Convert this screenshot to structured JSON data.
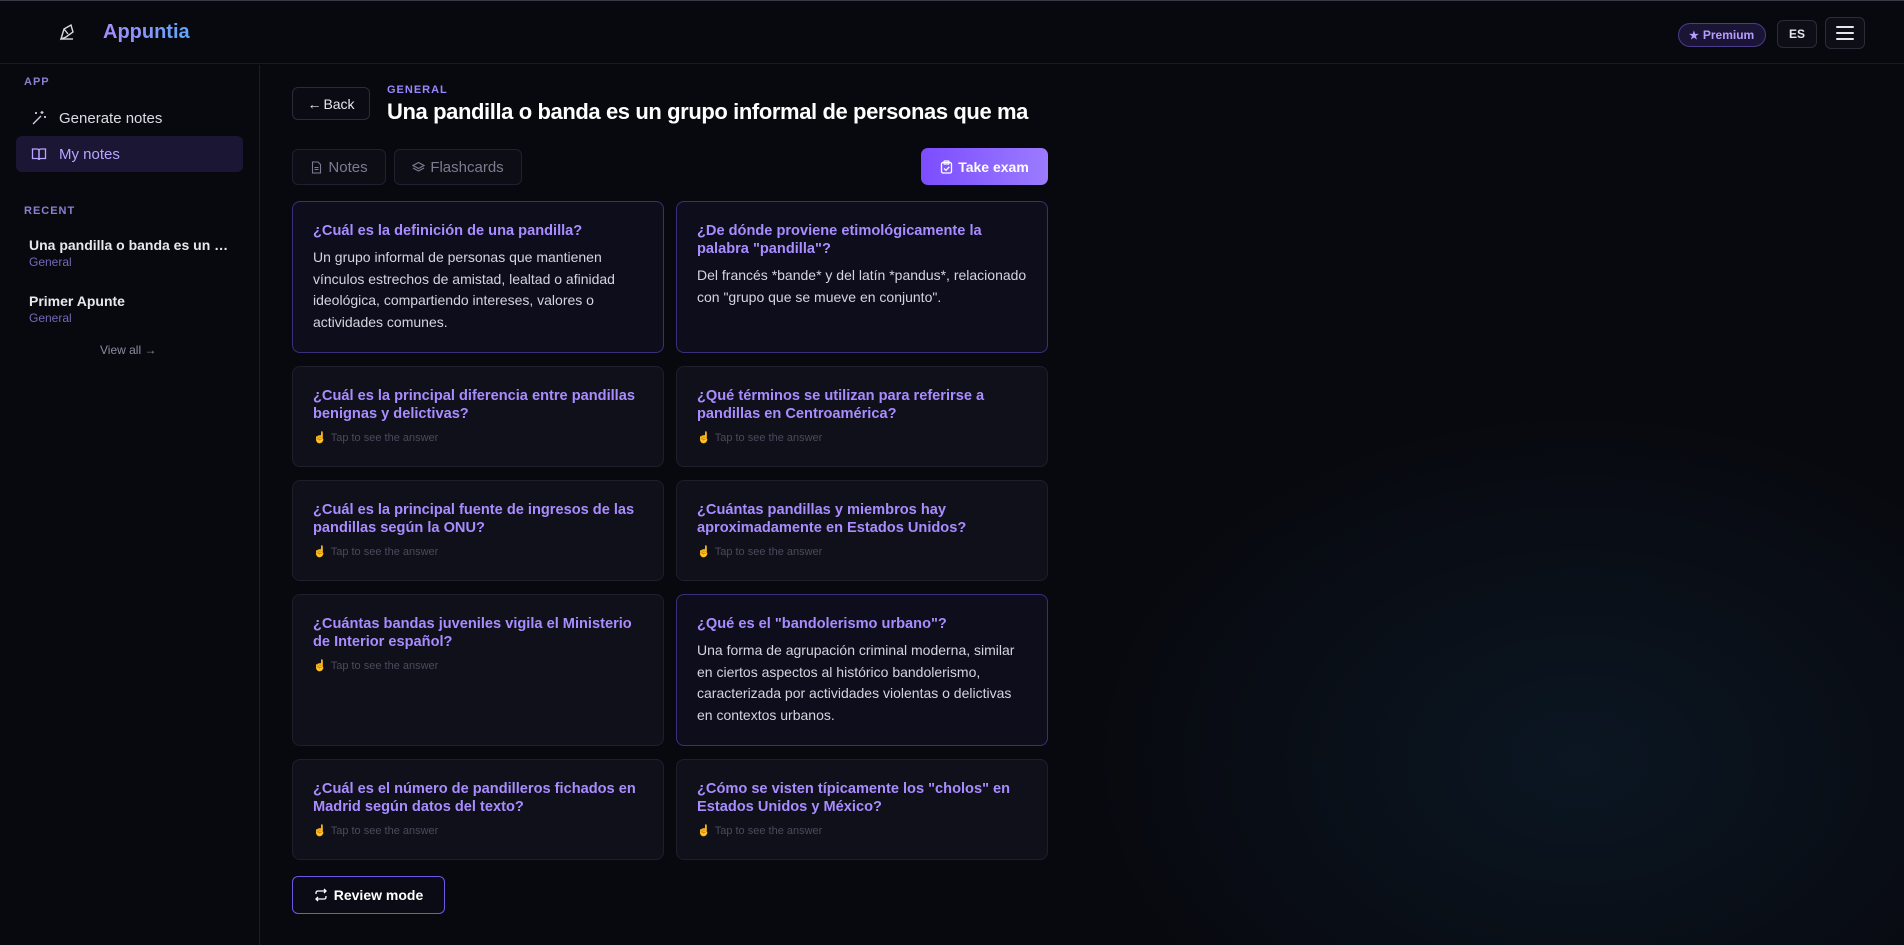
{
  "header": {
    "app_name": "Appuntia",
    "premium_label": "Premium",
    "language": "ES",
    "icons": {
      "logo": "feather-pen-icon",
      "premium": "star-icon",
      "menu": "hamburger-menu-icon"
    }
  },
  "sidebar": {
    "app_section_label": "APP",
    "nav": [
      {
        "label": "Generate notes",
        "icon": "sparkles-icon",
        "active": false
      },
      {
        "label": "My notes",
        "icon": "open-book-icon",
        "active": true
      }
    ],
    "recent_section_label": "RECENT",
    "recent": [
      {
        "title": "Una pandilla o banda es un grupo informal de personas que ma",
        "category": "General"
      },
      {
        "title": "Primer Apunte",
        "category": "General"
      }
    ],
    "view_all_label": "View all →"
  },
  "main": {
    "back_label": "Back",
    "breadcrumb": "GENERAL",
    "title": "Una pandilla o banda es un grupo informal de personas que ma",
    "tabs": [
      {
        "label": "Notes",
        "icon": "document-icon"
      },
      {
        "label": "Flashcards",
        "icon": "layers-icon"
      }
    ],
    "take_exam_label": "Take exam",
    "tap_hint": "Tap to see the answer",
    "cards": [
      {
        "question": "¿Cuál es la definición de una pandilla?",
        "answer": "Un grupo informal de personas que mantienen vínculos estrechos de amistad, lealtad o afinidad ideológica, compartiendo intereses, valores o actividades comunes.",
        "revealed": true
      },
      {
        "question": "¿De dónde proviene etimológicamente la palabra \"pandilla\"?",
        "answer": "Del francés *bande* y del latín *pandus*, relacionado con \"grupo que se mueve en conjunto\".",
        "revealed": true
      },
      {
        "question": "¿Cuál es la principal diferencia entre pandillas benignas y delictivas?",
        "answer": "",
        "revealed": false
      },
      {
        "question": "¿Qué términos se utilizan para referirse a pandillas en Centroamérica?",
        "answer": "",
        "revealed": false
      },
      {
        "question": "¿Cuál es la principal fuente de ingresos de las pandillas según la ONU?",
        "answer": "",
        "revealed": false
      },
      {
        "question": "¿Cuántas pandillas y miembros hay aproximadamente en Estados Unidos?",
        "answer": "",
        "revealed": false
      },
      {
        "question": "¿Cuántas bandas juveniles vigila el Ministerio de Interior español?",
        "answer": "",
        "revealed": false
      },
      {
        "question": "¿Qué es el \"bandolerismo urbano\"?",
        "answer": "Una forma de agrupación criminal moderna, similar en ciertos aspectos al histórico bandolerismo, caracterizada por actividades violentas o delictivas en contextos urbanos.",
        "revealed": true
      },
      {
        "question": "¿Cuál es el número de pandilleros fichados en Madrid según datos del texto?",
        "answer": "",
        "revealed": false
      },
      {
        "question": "¿Cómo se visten típicamente los \"cholos\" en Estados Unidos y México?",
        "answer": "",
        "revealed": false
      }
    ],
    "review_mode_label": "Review mode"
  },
  "colors": {
    "accent": "#8b5cf6",
    "question": "#a98cff",
    "background": "#08090f"
  }
}
